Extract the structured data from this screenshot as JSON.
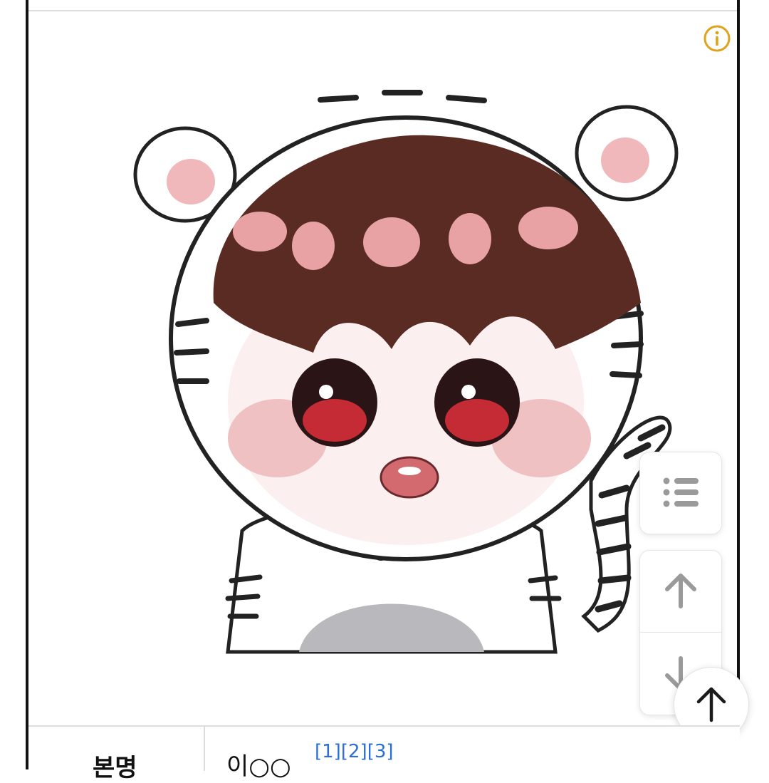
{
  "colors": {
    "frame_border": "#111111",
    "info_icon": "#e0a21b",
    "link": "#2b6fd6",
    "button_icon": "#9a9a9a"
  },
  "info_icon": "info-circle-icon",
  "artwork": {
    "description_icon": "tiger-hood-chibi-illustration"
  },
  "floating_buttons": {
    "toc_icon": "list-icon",
    "up_icon": "arrow-up-icon",
    "down_icon": "arrow-down-icon",
    "scroll_top_icon": "arrow-up-icon"
  },
  "infobox": {
    "label": "본명",
    "value": "이○○",
    "refs": [
      "[1]",
      "[2]",
      "[3]"
    ]
  }
}
